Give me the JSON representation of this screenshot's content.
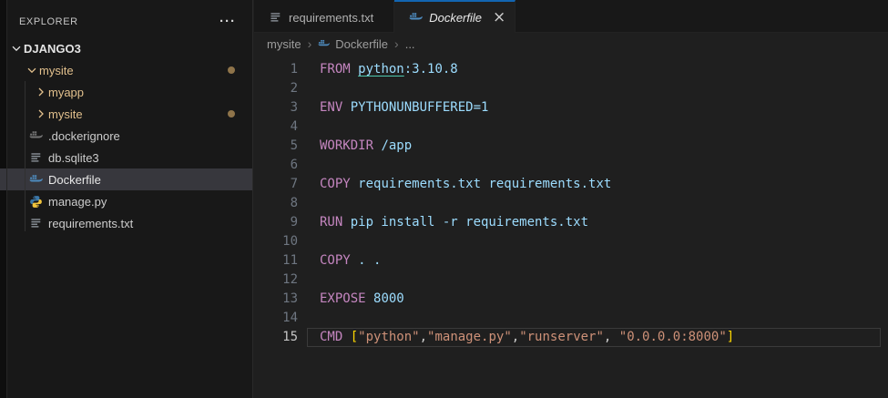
{
  "colors": {
    "accent": "#1265B1",
    "keyword": "#C586C0",
    "argument": "#9CDCFE",
    "string": "#CE9178",
    "bracket": "#FFD700",
    "punct": "#CCCCCC",
    "link_underline": "#4EC9B0",
    "git_modified": "#E2C08D",
    "badge_dot": "#8F744A",
    "line_number": "#6E7681",
    "line_number_active": "#C6C6C6",
    "selection_bg": "#37373D",
    "whale_blue": "#4E8CC0",
    "whale_gray": "#757575",
    "python_blue": "#3B77A8",
    "python_yellow": "#F0C33C",
    "file_icon_gray": "#8A9199"
  },
  "sidebar": {
    "header": {
      "title": "EXPLORER",
      "menu": "···"
    },
    "tree": [
      {
        "label": "DJANGO3",
        "type": "root-folder",
        "expanded": true
      },
      {
        "label": "mysite",
        "type": "folder",
        "expanded": true,
        "modified": true
      },
      {
        "label": "myapp",
        "type": "folder",
        "expanded": false,
        "modified": true
      },
      {
        "label": "mysite",
        "type": "folder",
        "expanded": false,
        "modified": true
      },
      {
        "label": ".dockerignore",
        "type": "file",
        "icon": "docker-whale-gray"
      },
      {
        "label": "db.sqlite3",
        "type": "file",
        "icon": "text-file"
      },
      {
        "label": "Dockerfile",
        "type": "file",
        "icon": "docker-whale",
        "selected": true
      },
      {
        "label": "manage.py",
        "type": "file",
        "icon": "python"
      },
      {
        "label": "requirements.txt",
        "type": "file",
        "icon": "text-file"
      }
    ]
  },
  "editor": {
    "tabs": [
      {
        "label": "requirements.txt",
        "icon": "text-file",
        "active": false
      },
      {
        "label": "Dockerfile",
        "icon": "docker-whale",
        "active": true,
        "preview": true,
        "close": "×"
      }
    ],
    "breadcrumb": {
      "items": [
        "mysite",
        "Dockerfile",
        "..."
      ],
      "separator": "›"
    },
    "code": {
      "active_line": 15,
      "lines": [
        {
          "num": "1",
          "tokens": [
            {
              "t": "FROM ",
              "c": "kw"
            },
            {
              "t": "python",
              "c": "link"
            },
            {
              "t": ":3.10.8",
              "c": "arg"
            }
          ]
        },
        {
          "num": "2",
          "tokens": []
        },
        {
          "num": "3",
          "tokens": [
            {
              "t": "ENV ",
              "c": "kw"
            },
            {
              "t": "PYTHONUNBUFFERED=1",
              "c": "arg"
            }
          ]
        },
        {
          "num": "4",
          "tokens": []
        },
        {
          "num": "5",
          "tokens": [
            {
              "t": "WORKDIR ",
              "c": "kw"
            },
            {
              "t": "/app",
              "c": "arg"
            }
          ]
        },
        {
          "num": "6",
          "tokens": []
        },
        {
          "num": "7",
          "tokens": [
            {
              "t": "COPY ",
              "c": "kw"
            },
            {
              "t": "requirements.txt requirements.txt",
              "c": "arg"
            }
          ]
        },
        {
          "num": "8",
          "tokens": []
        },
        {
          "num": "9",
          "tokens": [
            {
              "t": "RUN ",
              "c": "kw"
            },
            {
              "t": "pip install -r requirements.txt",
              "c": "arg"
            }
          ]
        },
        {
          "num": "10",
          "tokens": []
        },
        {
          "num": "11",
          "tokens": [
            {
              "t": "COPY ",
              "c": "kw"
            },
            {
              "t": ". .",
              "c": "arg"
            }
          ]
        },
        {
          "num": "12",
          "tokens": []
        },
        {
          "num": "13",
          "tokens": [
            {
              "t": "EXPOSE ",
              "c": "kw"
            },
            {
              "t": "8000",
              "c": "arg"
            }
          ]
        },
        {
          "num": "14",
          "tokens": []
        },
        {
          "num": "15",
          "tokens": [
            {
              "t": "CMD ",
              "c": "kw"
            },
            {
              "t": "[",
              "c": "brk"
            },
            {
              "t": "\"python\"",
              "c": "str"
            },
            {
              "t": ",",
              "c": "pun"
            },
            {
              "t": "\"manage.py\"",
              "c": "str"
            },
            {
              "t": ",",
              "c": "pun"
            },
            {
              "t": "\"runserver\"",
              "c": "str"
            },
            {
              "t": ", ",
              "c": "pun"
            },
            {
              "t": "\"0.0.0.0:8000\"",
              "c": "str"
            },
            {
              "t": "]",
              "c": "brk"
            }
          ]
        }
      ]
    }
  }
}
